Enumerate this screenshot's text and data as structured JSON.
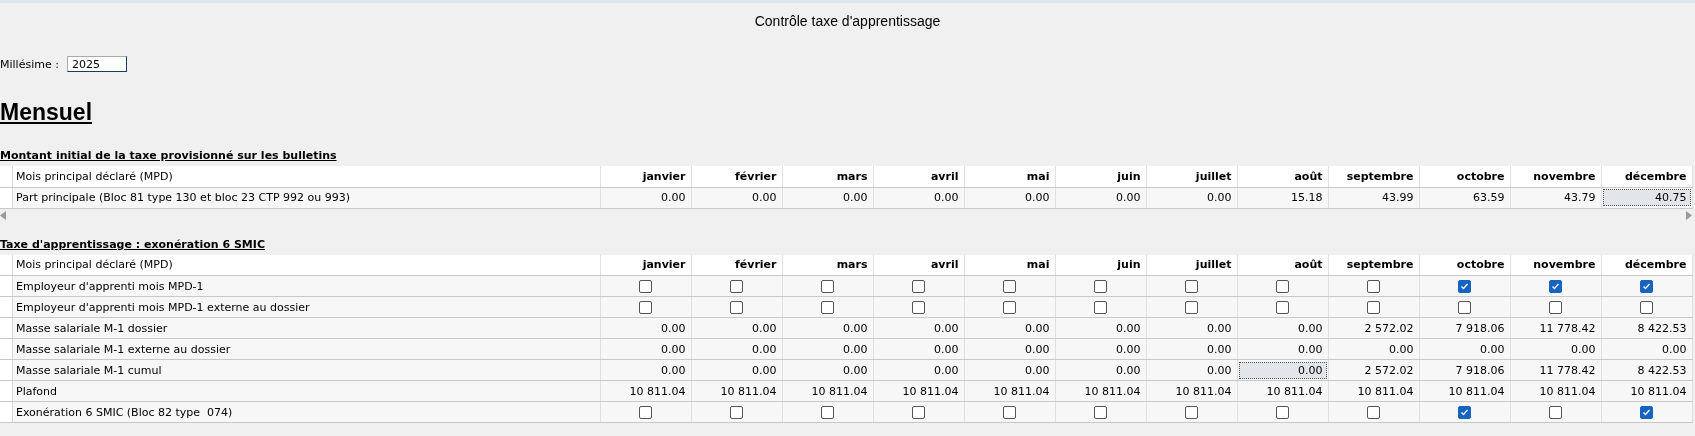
{
  "window": {
    "title": "Contrôle taxe d'apprentissage"
  },
  "millesime": {
    "label": "Millésime :",
    "value": "2025"
  },
  "heading": "Mensuel",
  "sections": [
    {
      "title": "Montant initial de la taxe provisionné sur les bulletins",
      "row_header_title": "Mois principal déclaré (MPD)",
      "columns": [
        "janvier",
        "février",
        "mars",
        "avril",
        "mai",
        "juin",
        "juillet",
        "août",
        "septembre",
        "octobre",
        "novembre",
        "décembre"
      ],
      "rows": [
        {
          "kind": "amount",
          "label": "Part principale (Bloc 81 type 130 et bloc 23 CTP 992 ou 993)",
          "cells": [
            {
              "text": "0.00",
              "selected": false
            },
            {
              "text": "0.00",
              "selected": false
            },
            {
              "text": "0.00",
              "selected": false
            },
            {
              "text": "0.00",
              "selected": false
            },
            {
              "text": "0.00",
              "selected": false
            },
            {
              "text": "0.00",
              "selected": false
            },
            {
              "text": "0.00",
              "selected": false
            },
            {
              "text": "15.18",
              "selected": false
            },
            {
              "text": "43.99",
              "selected": false
            },
            {
              "text": "63.59",
              "selected": false
            },
            {
              "text": "43.79",
              "selected": false
            },
            {
              "text": "40.75",
              "selected": true
            }
          ]
        }
      ]
    },
    {
      "title": "Taxe d'apprentissage : exonération 6 SMIC",
      "row_header_title": "Mois principal déclaré (MPD)",
      "columns": [
        "janvier",
        "février",
        "mars",
        "avril",
        "mai",
        "juin",
        "juillet",
        "août",
        "septembre",
        "octobre",
        "novembre",
        "décembre"
      ],
      "rows": [
        {
          "kind": "checkbox",
          "label": "Employeur d'apprenti mois MPD-1",
          "cells": [
            {
              "checked": false
            },
            {
              "checked": false
            },
            {
              "checked": false
            },
            {
              "checked": false
            },
            {
              "checked": false
            },
            {
              "checked": false
            },
            {
              "checked": false
            },
            {
              "checked": false
            },
            {
              "checked": false
            },
            {
              "checked": true
            },
            {
              "checked": true
            },
            {
              "checked": true
            }
          ]
        },
        {
          "kind": "checkbox",
          "label": "Employeur d'apprenti mois MPD-1 externe au dossier",
          "cells": [
            {
              "checked": false
            },
            {
              "checked": false
            },
            {
              "checked": false
            },
            {
              "checked": false
            },
            {
              "checked": false
            },
            {
              "checked": false
            },
            {
              "checked": false
            },
            {
              "checked": false
            },
            {
              "checked": false
            },
            {
              "checked": false
            },
            {
              "checked": false
            },
            {
              "checked": false
            }
          ]
        },
        {
          "kind": "amount",
          "label": "Masse salariale M-1 dossier",
          "cells": [
            {
              "text": "0.00",
              "selected": false
            },
            {
              "text": "0.00",
              "selected": false
            },
            {
              "text": "0.00",
              "selected": false
            },
            {
              "text": "0.00",
              "selected": false
            },
            {
              "text": "0.00",
              "selected": false
            },
            {
              "text": "0.00",
              "selected": false
            },
            {
              "text": "0.00",
              "selected": false
            },
            {
              "text": "0.00",
              "selected": false
            },
            {
              "text": "2 572.02",
              "selected": false
            },
            {
              "text": "7 918.06",
              "selected": false
            },
            {
              "text": "11 778.42",
              "selected": false
            },
            {
              "text": "8 422.53",
              "selected": false
            }
          ]
        },
        {
          "kind": "amount",
          "label": "Masse salariale M-1 externe au dossier",
          "cells": [
            {
              "text": "0.00",
              "selected": false
            },
            {
              "text": "0.00",
              "selected": false
            },
            {
              "text": "0.00",
              "selected": false
            },
            {
              "text": "0.00",
              "selected": false
            },
            {
              "text": "0.00",
              "selected": false
            },
            {
              "text": "0.00",
              "selected": false
            },
            {
              "text": "0.00",
              "selected": false
            },
            {
              "text": "0.00",
              "selected": false
            },
            {
              "text": "0.00",
              "selected": false
            },
            {
              "text": "0.00",
              "selected": false
            },
            {
              "text": "0.00",
              "selected": false
            },
            {
              "text": "0.00",
              "selected": false
            }
          ]
        },
        {
          "kind": "amount",
          "label": "Masse salariale M-1 cumul",
          "cells": [
            {
              "text": "0.00",
              "selected": false
            },
            {
              "text": "0.00",
              "selected": false
            },
            {
              "text": "0.00",
              "selected": false
            },
            {
              "text": "0.00",
              "selected": false
            },
            {
              "text": "0.00",
              "selected": false
            },
            {
              "text": "0.00",
              "selected": false
            },
            {
              "text": "0.00",
              "selected": false
            },
            {
              "text": "0.00",
              "selected": true
            },
            {
              "text": "2 572.02",
              "selected": false
            },
            {
              "text": "7 918.06",
              "selected": false
            },
            {
              "text": "11 778.42",
              "selected": false
            },
            {
              "text": "8 422.53",
              "selected": false
            }
          ]
        },
        {
          "kind": "amount",
          "label": "Plafond",
          "cells": [
            {
              "text": "10 811.04",
              "selected": false
            },
            {
              "text": "10 811.04",
              "selected": false
            },
            {
              "text": "10 811.04",
              "selected": false
            },
            {
              "text": "10 811.04",
              "selected": false
            },
            {
              "text": "10 811.04",
              "selected": false
            },
            {
              "text": "10 811.04",
              "selected": false
            },
            {
              "text": "10 811.04",
              "selected": false
            },
            {
              "text": "10 811.04",
              "selected": false
            },
            {
              "text": "10 811.04",
              "selected": false
            },
            {
              "text": "10 811.04",
              "selected": false
            },
            {
              "text": "10 811.04",
              "selected": false
            },
            {
              "text": "10 811.04",
              "selected": false
            }
          ]
        },
        {
          "kind": "checkbox",
          "label": "Exonération 6 SMIC (Bloc 82 type  074)",
          "cells": [
            {
              "checked": false
            },
            {
              "checked": false
            },
            {
              "checked": false
            },
            {
              "checked": false
            },
            {
              "checked": false
            },
            {
              "checked": false
            },
            {
              "checked": false
            },
            {
              "checked": false
            },
            {
              "checked": false
            },
            {
              "checked": true
            },
            {
              "checked": false
            },
            {
              "checked": true
            }
          ]
        }
      ]
    }
  ]
}
